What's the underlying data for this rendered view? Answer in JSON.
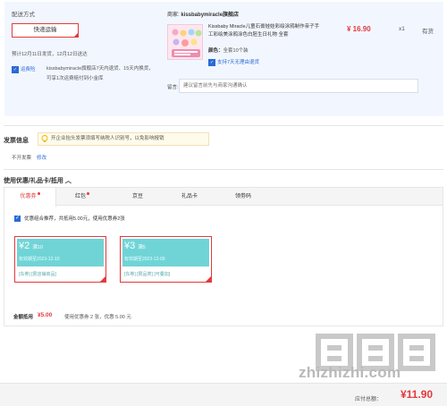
{
  "shipping": {
    "section_label": "配送方式",
    "method": "快递运输",
    "delivery_estimate": "预计12月11日发货，12月12日送达",
    "return_badge": "运费险",
    "return_policy": "kissbabymiracle旗舰店7天内退货、15天内换货，可享1次运费赔付到小金库"
  },
  "order_item": {
    "seller_label": "商家:",
    "seller_name": "kissbabymiracle旗舰店",
    "title": "Kissbaby Miracle儿童石膏娃娃彩绘涂鸦制作亲子手工彩绘美涂鸦涂色白胚生日礼物 全套",
    "color_label": "颜色：",
    "color_value": "全套10个装",
    "service_tag": "支持7天无理由退货",
    "price": "¥ 16.90",
    "quantity": "x1",
    "stock": "有货",
    "remark_label": "留言:",
    "remark_placeholder": "建议留言前先与商家沟通确认"
  },
  "invoice": {
    "title": "发票信息",
    "tip": "开企业抬头发票须填写纳税人识别号，以免影响报销",
    "state": "不开发票",
    "edit_link": "修改"
  },
  "coupons": {
    "title": "使用优惠/礼品卡/抵用",
    "tabs": [
      {
        "label": "优惠券",
        "dot": true
      },
      {
        "label": "红包",
        "dot": true
      },
      {
        "label": "京豆",
        "dot": false
      },
      {
        "label": "礼品卡",
        "dot": false
      },
      {
        "label": "领劵码",
        "dot": false
      }
    ],
    "combo_text": "优惠组合推荐，共抵用5.00元，使用优惠券2张",
    "cards": [
      {
        "symbol": "¥",
        "amount": "2",
        "condition": "满10",
        "valid": "有效期至2023-12-10",
        "scope": "[东券] [限店铺商品]"
      },
      {
        "symbol": "¥",
        "amount": "3",
        "condition": "满5",
        "valid": "有效期至2023-12-09",
        "scope": "[东券] [限品类] [可叠加]"
      }
    ],
    "discount_label": "金额抵用",
    "discount_amount": "¥5.00",
    "discount_note": "使用优惠券 2 张，优惠 5.00 元"
  },
  "summary": {
    "pay_label": "应付总额：",
    "pay_total": "¥11.90"
  },
  "watermark": {
    "text": "zhizhizhi.com"
  },
  "colors": {
    "accent_red": "#e4393c",
    "link_blue": "#2a6ad6",
    "coupon_teal": "#70d4d6"
  }
}
